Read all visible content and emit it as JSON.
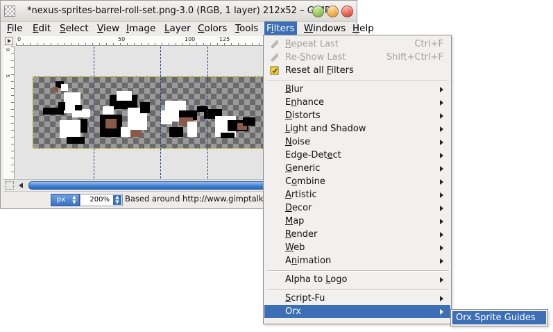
{
  "window": {
    "title": "*nexus-sprites-barrel-roll-set.png-3.0 (RGB, 1 layer) 212x52 – GIMP"
  },
  "menubar": [
    {
      "name": "file",
      "label": "File",
      "u": 0
    },
    {
      "name": "edit",
      "label": "Edit",
      "u": 0
    },
    {
      "name": "select",
      "label": "Select",
      "u": 0
    },
    {
      "name": "view",
      "label": "View",
      "u": 0
    },
    {
      "name": "image",
      "label": "Image",
      "u": 0
    },
    {
      "name": "layer",
      "label": "Layer",
      "u": 0
    },
    {
      "name": "colors",
      "label": "Colors",
      "u": 0
    },
    {
      "name": "tools",
      "label": "Tools",
      "u": 0
    },
    {
      "name": "filters",
      "label": "Filters",
      "u": 1,
      "active": true
    },
    {
      "name": "windows",
      "label": "Windows",
      "u": 0
    },
    {
      "name": "help",
      "label": "Help",
      "u": 0
    }
  ],
  "ruler": {
    "top_labels": [
      "0",
      "50",
      "100",
      "125"
    ],
    "side_labels": [
      "0",
      "5"
    ]
  },
  "statusbar": {
    "unit": "px",
    "zoom": "200%",
    "text": "Based around http://www.gimptalk.com"
  },
  "filters_menu": {
    "items": [
      {
        "type": "item",
        "name": "repeat-last",
        "label": "Repeat Last",
        "u": 0,
        "accel": "Ctrl+F",
        "disabled": true,
        "icon": "repeat-icon"
      },
      {
        "type": "item",
        "name": "reshow-last",
        "label": "Re-Show Last",
        "u": 3,
        "accel": "Shift+Ctrl+F",
        "disabled": true,
        "icon": "reshow-icon"
      },
      {
        "type": "item",
        "name": "reset-all-filters",
        "label": "Reset all Filters",
        "u": 10,
        "icon": "reset-icon"
      },
      {
        "type": "sep"
      },
      {
        "type": "item",
        "name": "blur",
        "label": "Blur",
        "u": 0,
        "submenu": true
      },
      {
        "type": "item",
        "name": "enhance",
        "label": "Enhance",
        "u": 1,
        "submenu": true
      },
      {
        "type": "item",
        "name": "distorts",
        "label": "Distorts",
        "u": 0,
        "submenu": true
      },
      {
        "type": "item",
        "name": "light-and-shadow",
        "label": "Light and Shadow",
        "u": 0,
        "submenu": true
      },
      {
        "type": "item",
        "name": "noise",
        "label": "Noise",
        "u": 0,
        "submenu": true
      },
      {
        "type": "item",
        "name": "edge-detect",
        "label": "Edge-Detect",
        "u": 8,
        "submenu": true
      },
      {
        "type": "item",
        "name": "generic",
        "label": "Generic",
        "u": 0,
        "submenu": true
      },
      {
        "type": "item",
        "name": "combine",
        "label": "Combine",
        "u": 1,
        "submenu": true
      },
      {
        "type": "item",
        "name": "artistic",
        "label": "Artistic",
        "u": 0,
        "submenu": true
      },
      {
        "type": "item",
        "name": "decor",
        "label": "Decor",
        "u": 0,
        "submenu": true
      },
      {
        "type": "item",
        "name": "map",
        "label": "Map",
        "u": 0,
        "submenu": true
      },
      {
        "type": "item",
        "name": "render",
        "label": "Render",
        "u": 0,
        "submenu": true
      },
      {
        "type": "item",
        "name": "web",
        "label": "Web",
        "u": 0,
        "submenu": true
      },
      {
        "type": "item",
        "name": "animation",
        "label": "Animation",
        "u": 1,
        "submenu": true
      },
      {
        "type": "sep"
      },
      {
        "type": "item",
        "name": "alpha-to-logo",
        "label": "Alpha to Logo",
        "u": 9,
        "submenu": true
      },
      {
        "type": "sep"
      },
      {
        "type": "item",
        "name": "script-fu",
        "label": "Script-Fu",
        "u": 0,
        "submenu": true
      },
      {
        "type": "item",
        "name": "orx",
        "label": "Orx",
        "u": -1,
        "submenu": true,
        "highlighted": true
      }
    ]
  },
  "orx_submenu": {
    "items": [
      {
        "name": "orx-sprite-guides",
        "label": "Orx Sprite Guides"
      }
    ]
  },
  "colors": {
    "highlight": "#3c6fb5",
    "menu_bg": "#f1f0ef",
    "disabled_text": "#a4a29e"
  }
}
